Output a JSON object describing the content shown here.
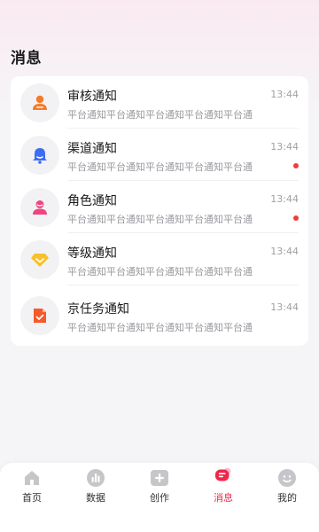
{
  "header": {
    "title": "消息"
  },
  "notifications": [
    {
      "title": "审核通知",
      "subtitle": "平台通知平台通知平台通知平台通知平台通",
      "time": "13:44",
      "unread": false,
      "icon": "review-person-icon"
    },
    {
      "title": "渠道通知",
      "subtitle": "平台通知平台通知平台通知平台通知平台通",
      "time": "13:44",
      "unread": true,
      "icon": "bell-icon"
    },
    {
      "title": "角色通知",
      "subtitle": "平台通知平台通知平台通知平台通知平台通",
      "time": "13:44",
      "unread": true,
      "icon": "role-person-icon"
    },
    {
      "title": "等级通知",
      "subtitle": "平台通知平台通知平台通知平台通知平台通",
      "time": "13:44",
      "unread": false,
      "icon": "diamond-icon"
    },
    {
      "title": "京任务通知",
      "subtitle": "平台通知平台通知平台通知平台通知平台通",
      "time": "13:44",
      "unread": false,
      "icon": "task-document-icon"
    }
  ],
  "tabbar": {
    "items": [
      {
        "label": "首页",
        "icon": "home-icon",
        "active": false
      },
      {
        "label": "数据",
        "icon": "data-chart-icon",
        "active": false
      },
      {
        "label": "创作",
        "icon": "create-plus-icon",
        "active": false
      },
      {
        "label": "消息",
        "icon": "message-icon",
        "active": true
      },
      {
        "label": "我的",
        "icon": "profile-icon",
        "active": false
      }
    ]
  },
  "colors": {
    "accent": "#f0264a",
    "unread_dot": "#f03c3c",
    "review_icon": "#f47a2a",
    "channel_icon": "#3d6cf5",
    "role_icon": "#f0447e",
    "level_icon": "#f6c12b",
    "task_icon": "#f45a2a",
    "inactive_tab_icon": "#c6c6ca"
  }
}
